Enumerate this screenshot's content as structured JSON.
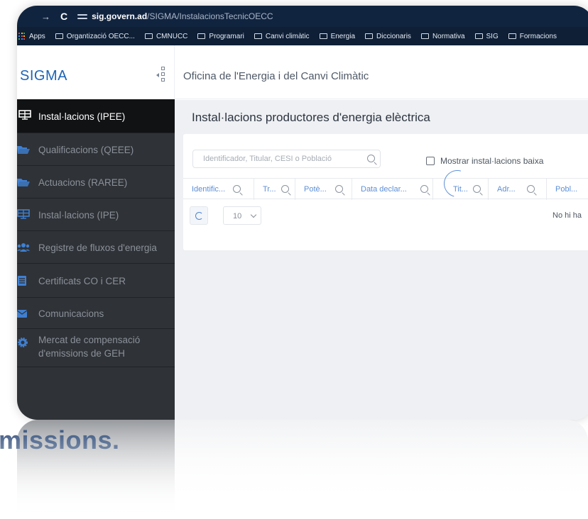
{
  "browser": {
    "nav_arrow": "→",
    "reload": "C",
    "url_host": "sig.govern.ad",
    "url_path": "/SIGMA/InstalacionsTecnicOECC"
  },
  "bookmarks": {
    "apps_label": "Apps",
    "items": [
      "Organtizació OECC...",
      "CMNUCC",
      "Programari",
      "Canvi climàtic",
      "Energia",
      "Diccionaris",
      "Normativa",
      "SIG",
      "Formacions"
    ]
  },
  "app": {
    "brand": "SIGMA",
    "organization": "Oficina de l'Energia i del Canvi Climàtic"
  },
  "sidebar": {
    "items": [
      {
        "label": "Instal·lacions (IPEE)",
        "icon": "solar-panel-icon",
        "active": true
      },
      {
        "label": "Qualificacions (QEEE)",
        "icon": "folder-open-icon",
        "active": false
      },
      {
        "label": "Actuacions (RAREE)",
        "icon": "folder-open-icon",
        "active": false
      },
      {
        "label": "Instal·lacions (IPE)",
        "icon": "solar-panel-icon",
        "active": false
      },
      {
        "label": "Registre de fluxos d'energia",
        "icon": "users-icon",
        "active": false
      },
      {
        "label": "Certificats CO i CER",
        "icon": "list-icon",
        "active": false
      },
      {
        "label": "Comunicacions",
        "icon": "envelope-icon",
        "active": false
      },
      {
        "label": "Mercat de compensació d'emissions de GEH",
        "icon": "gear-icon",
        "active": false
      }
    ]
  },
  "main": {
    "title": "Instal·lacions productores d'energia elèctrica",
    "search_placeholder": "Identificador, Titular, CESI o Població",
    "show_low_label": "Mostrar instal·lacions baixa",
    "columns": [
      "Identific...",
      "Tr...",
      "Potè...",
      "Data declar...",
      "Tit...",
      "Adr...",
      "Pobl..."
    ],
    "page_size": "10",
    "empty_message": "No hi ha"
  },
  "caption": {
    "reflection_text": "missions."
  },
  "colors": {
    "brand_blue": "#1e63b6",
    "sidebar_bg": "#2f3237",
    "column_header": "#5d8fd6",
    "browser_bar": "#11243f"
  }
}
